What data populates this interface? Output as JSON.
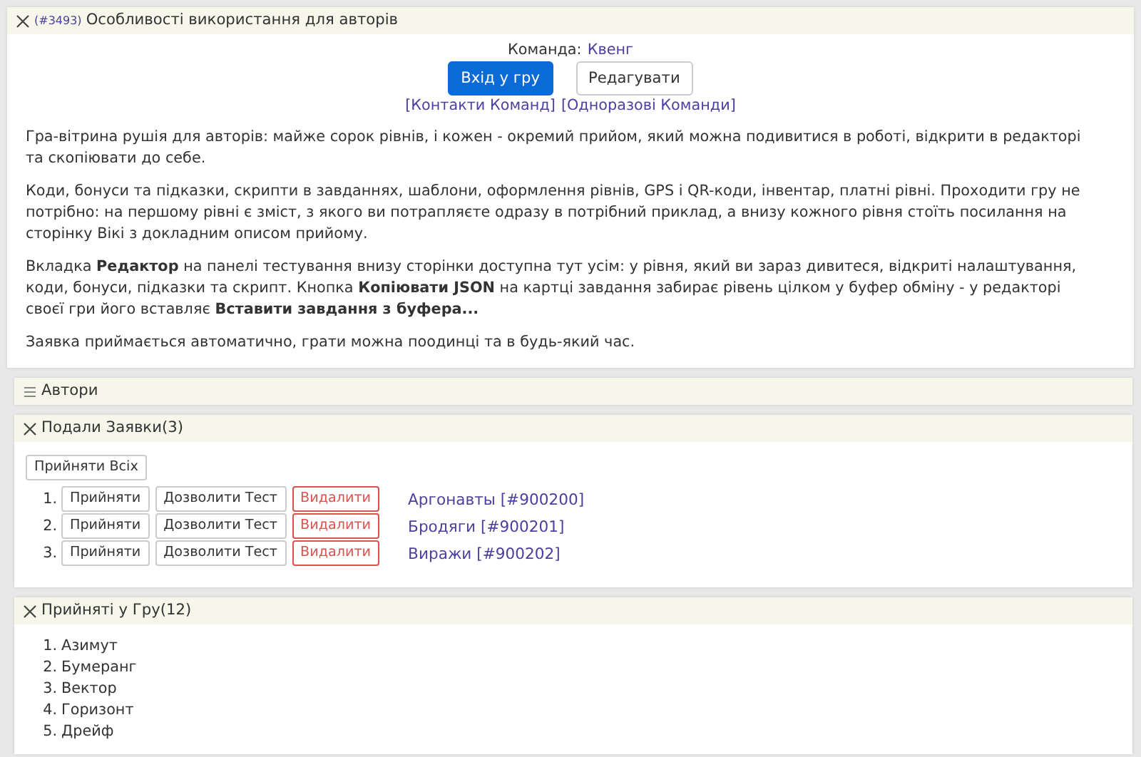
{
  "main": {
    "game_id": "(#3493)",
    "title": "Особливості використання для авторів",
    "expanded": true,
    "team_label": "Команда:",
    "team_name": "Квенг",
    "buttons": [
      {
        "label": "Вхід у гру",
        "kind": "primary"
      },
      {
        "label": "Редагувати",
        "kind": "secondary"
      }
    ],
    "links": [
      "[Контакти Команд]",
      "[Одноразові Команди]"
    ],
    "paragraphs": [
      "Гра-вітрина рушія для авторів: майже сорок рівнів, і кожен - окремий прийом, який можна подивитися в роботі, відкрити в редакторі та скопіювати до себе.",
      "Коди, бонуси та підказки, скрипти в завданнях, шаблони, оформлення рівнів, GPS і QR-коди, інвентар, платні рівні. Проходити гру не потрібно: на першому рівні є зміст, з якого ви потрапляєте одразу в потрібний приклад, а внизу кожного рівня стоїть посилання на сторінку Вікі з докладним описом прийому.",
      "Вкладка **Редактор** на панелі тестування внизу сторінки доступна тут усім: у рівня, який ви зараз дивитеся, відкриті налаштування, коди, бонуси, підказки та скрипт. Кнопка **Копіювати JSON** на картці завдання забирає рівень цілком у буфер обміну - у редакторі своєї гри його вставляє **Вставити завдання з буфера...**",
      "Заявка приймається автоматично, грати можна поодинці та в будь-який час."
    ]
  },
  "authors": {
    "title": "Автори",
    "expanded": false
  },
  "applications": {
    "title": "Подали Заявки(3)",
    "expanded": true,
    "accept_all": "Прийняти Всіх",
    "rows": [
      {
        "number": "1.",
        "accept": "Прийняти",
        "allow_test": "Дозволити Тест",
        "delete": "Видалити",
        "team": "Аргонавты [#900200]"
      },
      {
        "number": "2.",
        "accept": "Прийняти",
        "allow_test": "Дозволити Тест",
        "delete": "Видалити",
        "team": "Бродяги [#900201]"
      },
      {
        "number": "3.",
        "accept": "Прийняти",
        "allow_test": "Дозволити Тест",
        "delete": "Видалити",
        "team": "Виражи [#900202]"
      }
    ]
  },
  "accepted": {
    "title": "Прийняті у Гру(12)",
    "expanded": true,
    "teams": [
      {
        "number": "1.",
        "name": "Азимут"
      },
      {
        "number": "2.",
        "name": "Бумеранг"
      },
      {
        "number": "3.",
        "name": "Вектор"
      },
      {
        "number": "4.",
        "name": "Горизонт"
      },
      {
        "number": "5.",
        "name": "Дрейф"
      }
    ]
  }
}
